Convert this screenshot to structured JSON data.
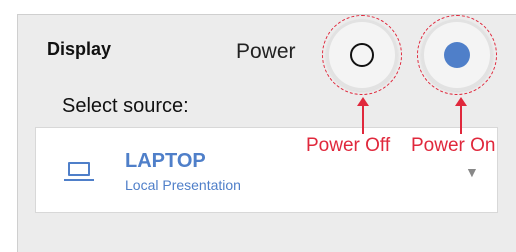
{
  "panel": {
    "title": "Display",
    "power_label": "Power",
    "select_source_label": "Select source:"
  },
  "source": {
    "name": "LAPTOP",
    "subtitle": "Local Presentation",
    "icon": "laptop-icon",
    "dropdown_icon": "▼"
  },
  "power_buttons": {
    "off": {
      "state": "off",
      "icon": "hollow-circle-icon"
    },
    "on": {
      "state": "on",
      "icon": "filled-circle-icon"
    }
  },
  "annotations": {
    "power_off": "Power Off",
    "power_on": "Power On"
  },
  "colors": {
    "accent": "#4f7fc9",
    "annotation": "#e0283c",
    "panel_bg": "#ececec",
    "card_bg": "#ffffff"
  }
}
